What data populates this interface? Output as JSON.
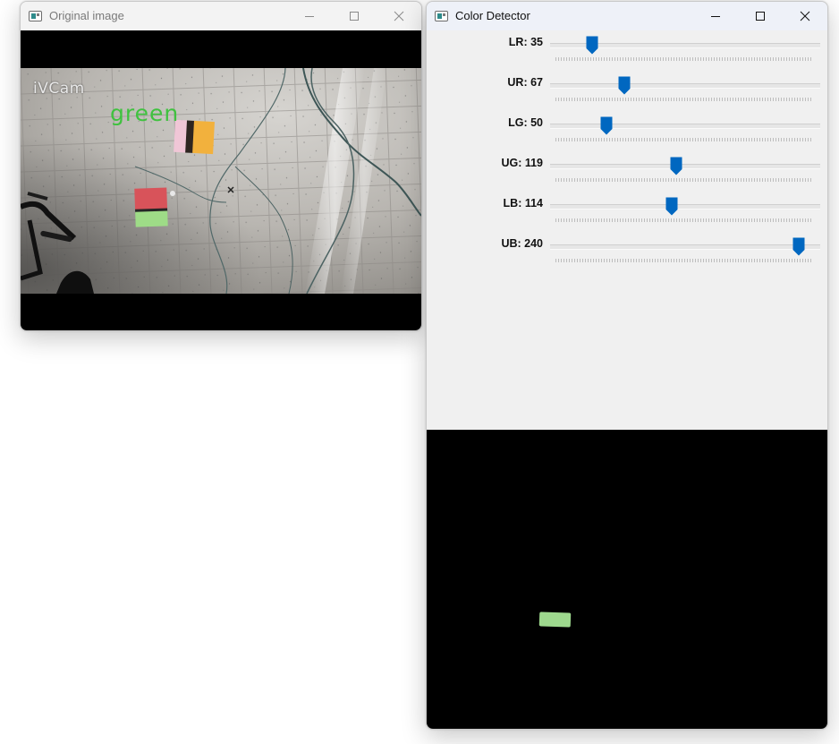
{
  "original_window": {
    "title": "Original image",
    "watermark": "iVCam",
    "detected_label": "green"
  },
  "detector_window": {
    "title": "Color Detector",
    "trackbars": [
      {
        "label": "LR: 35",
        "value": 35,
        "max": 255
      },
      {
        "label": "UR: 67",
        "value": 67,
        "max": 255
      },
      {
        "label": "LG: 50",
        "value": 50,
        "max": 255
      },
      {
        "label": "UG: 119",
        "value": 119,
        "max": 255
      },
      {
        "label": "LB: 114",
        "value": 114,
        "max": 255
      },
      {
        "label": "UB: 240",
        "value": 240,
        "max": 255
      }
    ]
  },
  "colors": {
    "thumb": "#0067c0",
    "detected_text": "#3fc23f",
    "mask_blob": "#9ed98e"
  },
  "icons": {
    "minimize": "minimize-icon",
    "maximize": "maximize-icon",
    "close": "close-icon",
    "app": "opencv-window-icon"
  }
}
